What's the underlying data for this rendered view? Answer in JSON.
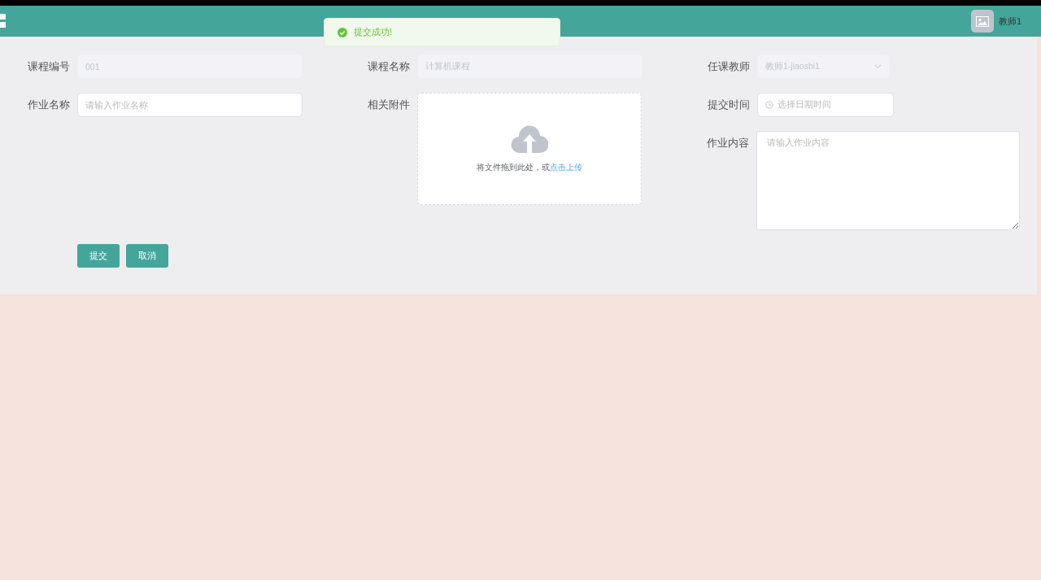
{
  "header": {
    "user_name": "教师1"
  },
  "toast": {
    "message": "提交成功!"
  },
  "form": {
    "columns": [
      [
        {
          "kind": "text",
          "label": "课程编号",
          "value": "001",
          "disabled": true
        },
        {
          "kind": "text",
          "label": "作业名称",
          "placeholder": "请输入作业名称",
          "disabled": false
        }
      ],
      [
        {
          "kind": "text",
          "label": "课程名称",
          "value": "计算机课程",
          "disabled": true
        },
        {
          "kind": "upload",
          "label": "相关附件",
          "hint": "将文件拖到此处，或",
          "link": "点击上传"
        }
      ],
      [
        {
          "kind": "select",
          "label": "任课教师",
          "value": "教师1-jiaoshi1",
          "disabled": true
        },
        {
          "kind": "date",
          "label": "提交时间",
          "placeholder": "选择日期时间"
        },
        {
          "kind": "textarea",
          "label": "作业内容",
          "placeholder": "请输入作业内容"
        }
      ]
    ],
    "buttons": [
      "提交",
      "取消"
    ]
  }
}
